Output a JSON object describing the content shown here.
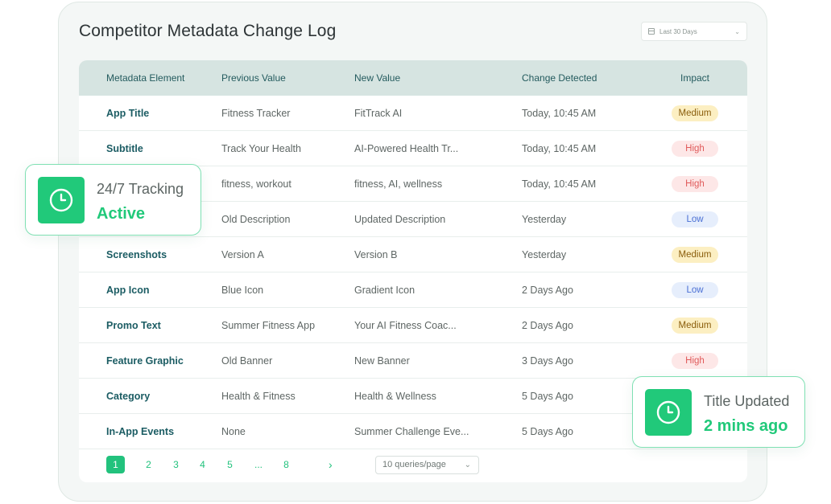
{
  "title": "Competitor Metadata Change Log",
  "date_filter": {
    "value": "Last 30 Days"
  },
  "table": {
    "headers": [
      "Metadata Element",
      "Previous Value",
      "New Value",
      "Change Detected",
      "Impact"
    ],
    "rows": [
      {
        "element": "App Title",
        "previous": "Fitness Tracker",
        "new": "FitTrack AI",
        "detected": "Today, 10:45 AM",
        "impact": "Medium"
      },
      {
        "element": "Subtitle",
        "previous": "Track Your Health",
        "new": "AI-Powered Health Tr...",
        "detected": "Today, 10:45 AM",
        "impact": "High"
      },
      {
        "element": "",
        "previous": "fitness, workout",
        "new": "fitness, AI, wellness",
        "detected": "Today, 10:45 AM",
        "impact": "High"
      },
      {
        "element": "",
        "previous": "Old Description",
        "new": "Updated Description",
        "detected": "Yesterday",
        "impact": "Low"
      },
      {
        "element": "Screenshots",
        "previous": "Version A",
        "new": "Version B",
        "detected": "Yesterday",
        "impact": "Medium"
      },
      {
        "element": "App Icon",
        "previous": "Blue Icon",
        "new": "Gradient Icon",
        "detected": "2 Days Ago",
        "impact": "Low"
      },
      {
        "element": "Promo Text",
        "previous": "Summer Fitness App",
        "new": "Your AI Fitness Coac...",
        "detected": "2 Days Ago",
        "impact": "Medium"
      },
      {
        "element": "Feature Graphic",
        "previous": "Old Banner",
        "new": "New Banner",
        "detected": "3 Days Ago",
        "impact": "High"
      },
      {
        "element": "Category",
        "previous": "Health & Fitness",
        "new": "Health & Wellness",
        "detected": "5 Days Ago",
        "impact": ""
      },
      {
        "element": "In-App Events",
        "previous": "None",
        "new": "Summer Challenge Eve...",
        "detected": "5 Days Ago",
        "impact": ""
      }
    ]
  },
  "pagination": {
    "pages": [
      "1",
      "2",
      "3",
      "4",
      "5"
    ],
    "ellipsis": "...",
    "last": "8",
    "next": "›",
    "per_page": "10 queries/page"
  },
  "cards": {
    "tracking": {
      "label": "24/7 Tracking",
      "value": "Active",
      "icon": "clock-icon"
    },
    "updated": {
      "label": "Title Updated",
      "value": "2 mins ago",
      "icon": "clock-icon"
    }
  },
  "colors": {
    "accent": "#21c97a",
    "header_bg": "#d6e4e1",
    "element_text": "#1b5c63"
  }
}
